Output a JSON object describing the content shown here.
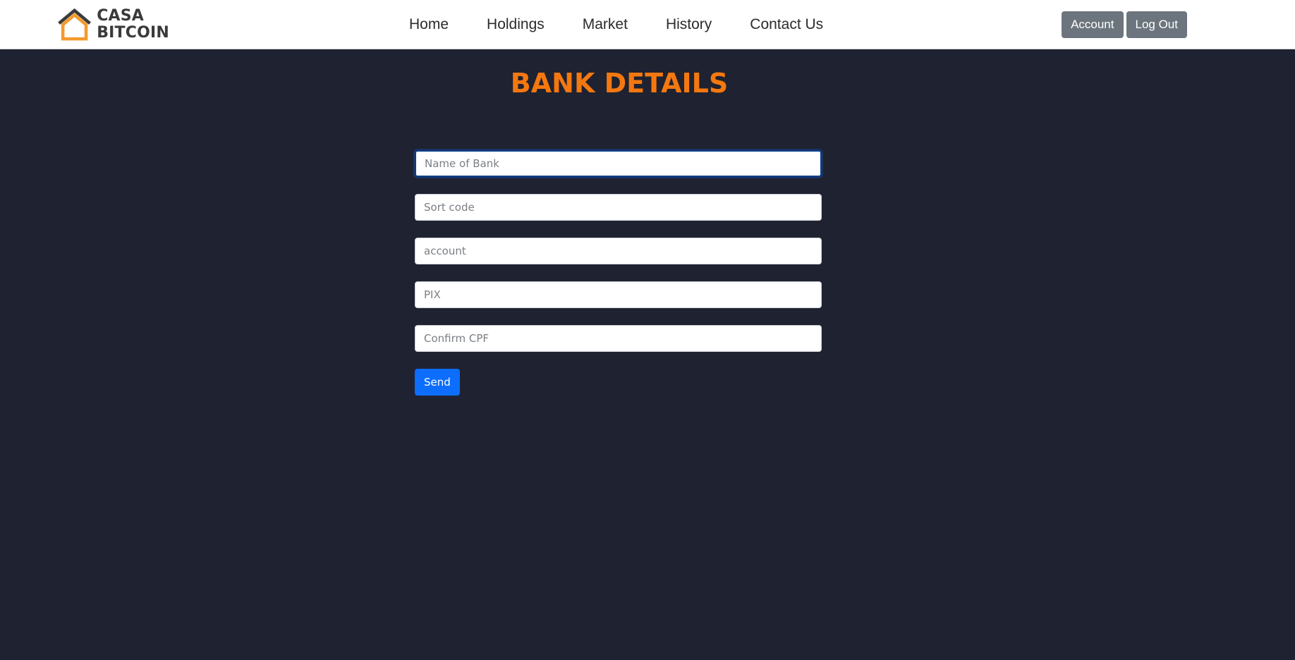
{
  "brand": {
    "line1": "CASA",
    "line2": "BITCOIN",
    "house_color": "#f39a2b",
    "roof_color": "#3a3a3a"
  },
  "nav": {
    "items": [
      {
        "label": "Home"
      },
      {
        "label": "Holdings"
      },
      {
        "label": "Market"
      },
      {
        "label": "History"
      },
      {
        "label": "Contact Us"
      }
    ],
    "account_label": "Account",
    "logout_label": "Log Out"
  },
  "page": {
    "title": "BANK DETAILS",
    "title_color": "#f4780f",
    "background": "#1f2230"
  },
  "form": {
    "fields": [
      {
        "placeholder": "Name of Bank",
        "value": ""
      },
      {
        "placeholder": "Sort code",
        "value": ""
      },
      {
        "placeholder": "account",
        "value": ""
      },
      {
        "placeholder": "PIX",
        "value": ""
      },
      {
        "placeholder": "Confirm CPF",
        "value": ""
      }
    ],
    "submit_label": "Send",
    "submit_color": "#0d6efd"
  }
}
